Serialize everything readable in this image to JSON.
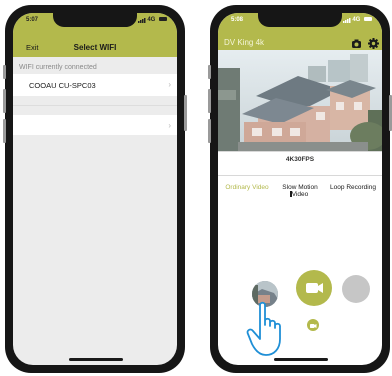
{
  "left_phone": {
    "status": {
      "time": "5:07",
      "network": "4G"
    },
    "header": {
      "exit_label": "Exit",
      "title": "Select WIFI"
    },
    "section_label": "WIFI currently connected",
    "networks": [
      {
        "name": "COOAU CU-SPC03"
      },
      {
        "name": ""
      }
    ],
    "icons": {
      "row_chevron": "chevron-right-icon"
    }
  },
  "right_phone": {
    "status": {
      "time": "5:08",
      "network": "4G"
    },
    "header": {
      "title": "DV King 4k",
      "icons": [
        "camera-settings-icon",
        "gear-icon"
      ]
    },
    "resolution_label": "4K30FPS",
    "modes": [
      {
        "label": "Ordinary Video",
        "active": true
      },
      {
        "label": "Slow Motion Video",
        "active": false
      },
      {
        "label": "Loop Recording",
        "active": false
      }
    ],
    "colors": {
      "accent": "#b3b94c",
      "inactive_button": "#c6c6c6"
    },
    "icons": {
      "thumbnail": "gallery-thumbnail",
      "record": "video-camera-icon",
      "resolution_button": "resolution-button",
      "pointer": "pointing-hand-icon"
    }
  }
}
